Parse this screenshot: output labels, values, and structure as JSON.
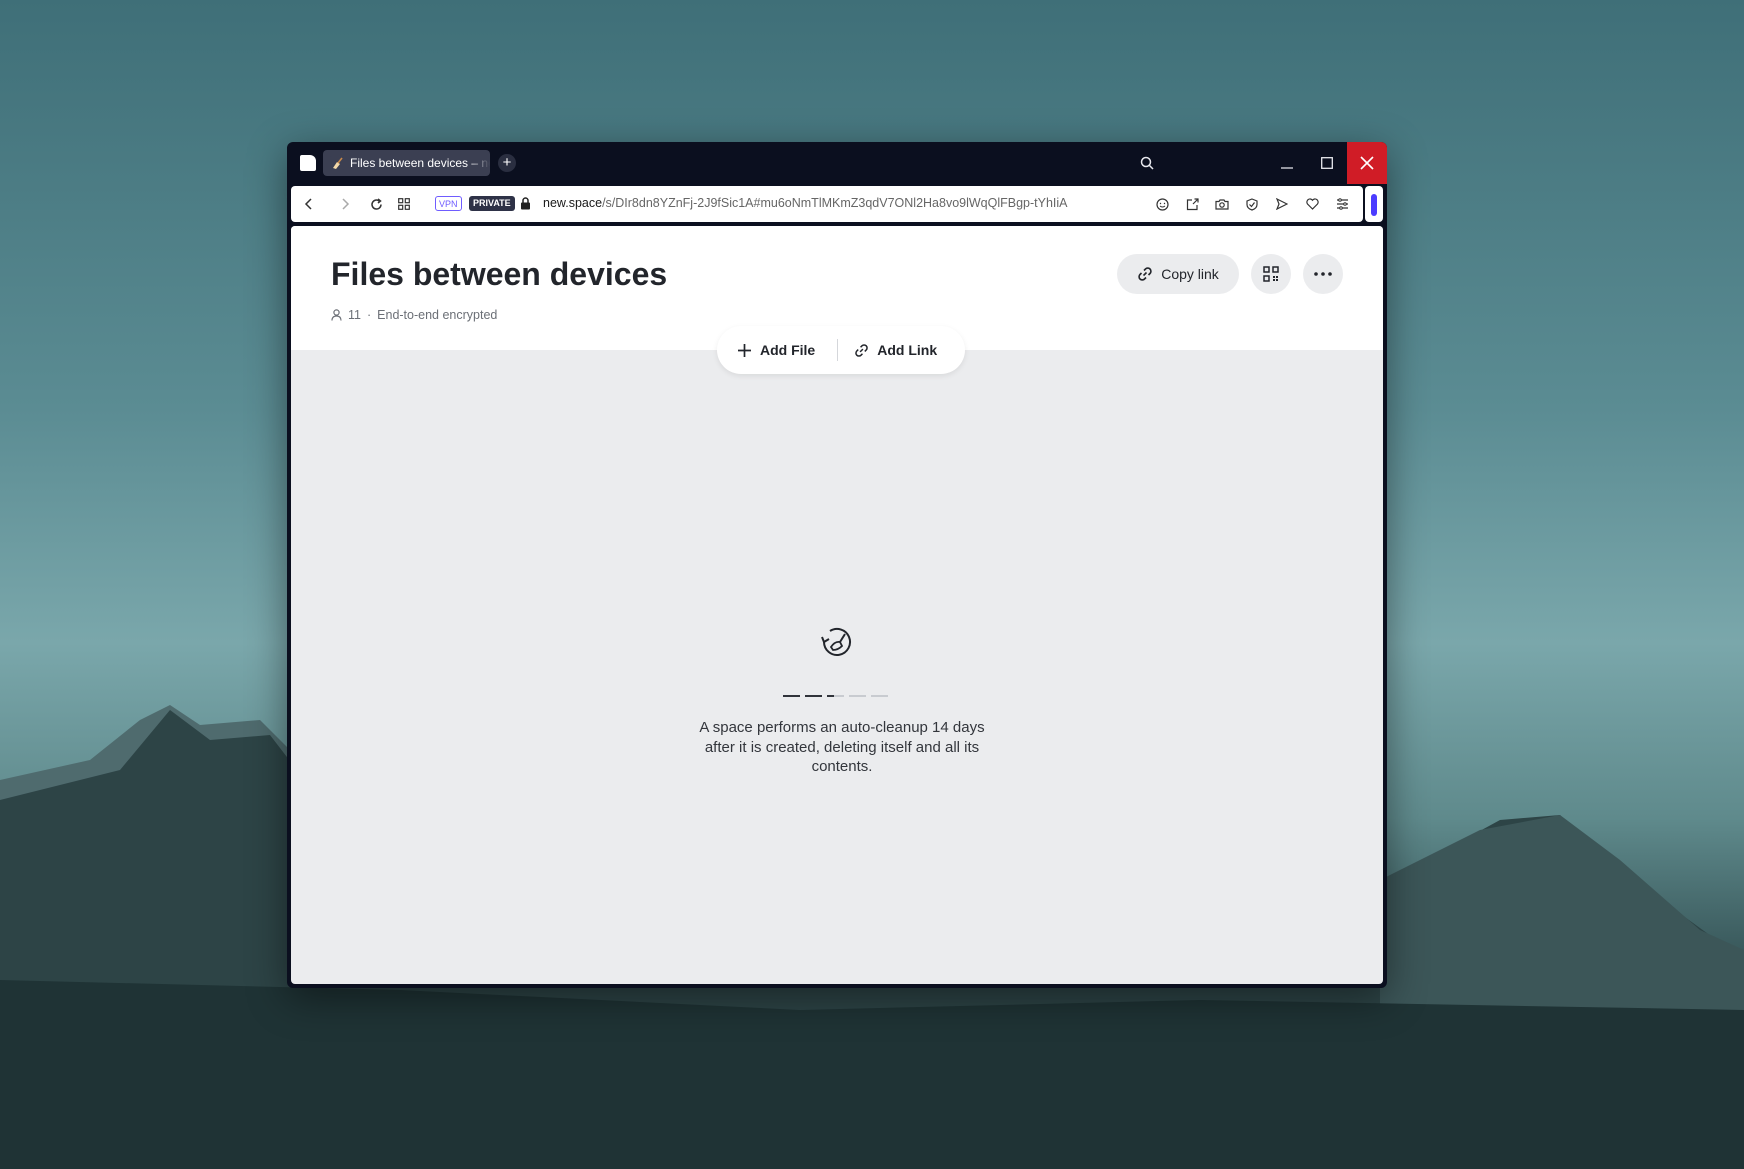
{
  "window": {
    "tab_title": "Files between devices – new.space",
    "new_tab_icon": "+"
  },
  "address_bar": {
    "vpn_badge": "VPN",
    "private_badge": "PRIVATE",
    "url_host": "new.space",
    "url_path": "/s/DIr8dn8YZnFj-2J9fSic1A#mu6oNmTlMKmZ3qdV7ONl2Ha8vo9lWqQlFBgp-tYhIiA"
  },
  "page": {
    "title": "Files between devices",
    "member_count": "11",
    "separator": "·",
    "encryption_status": "End-to-end encrypted",
    "copy_link_label": "Copy link",
    "add_file_label": "Add File",
    "add_link_label": "Add Link",
    "empty_message": "A space performs an auto-cleanup 14 days after it is created, deleting itself and all its contents."
  },
  "colors": {
    "accent": "#4b3cff",
    "close_button": "#d01c26",
    "window_frame": "#0b0f1f"
  }
}
